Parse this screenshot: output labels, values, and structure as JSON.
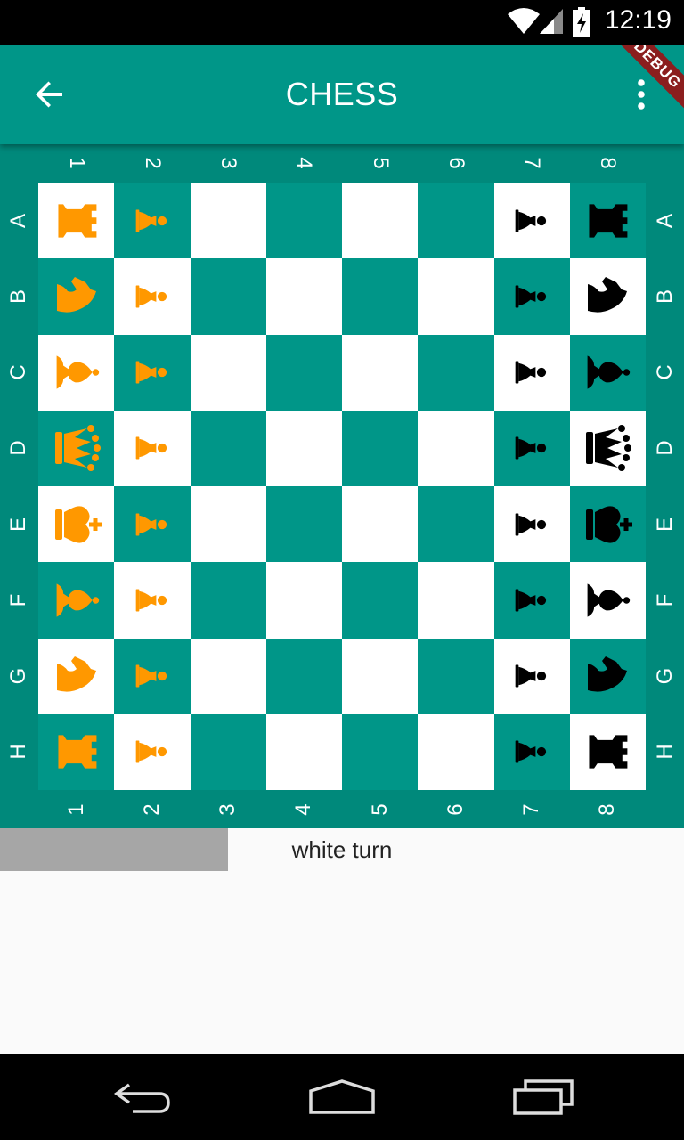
{
  "status_bar": {
    "time": "12:19"
  },
  "app_bar": {
    "title": "CHESS",
    "debug_banner": "DEBUG"
  },
  "board": {
    "column_labels": [
      "1",
      "2",
      "3",
      "4",
      "5",
      "6",
      "7",
      "8"
    ],
    "row_labels": [
      "A",
      "B",
      "C",
      "D",
      "E",
      "F",
      "G",
      "H"
    ],
    "colors": {
      "light_square": "#ffffff",
      "dark_square": "#009688",
      "frame": "#00897b",
      "white_pieces": "#ff9800",
      "black_pieces": "#000000"
    },
    "rows": [
      [
        "wR",
        "wP",
        "",
        "",
        "",
        "",
        "bP",
        "bR"
      ],
      [
        "wN",
        "wP",
        "",
        "",
        "",
        "",
        "bP",
        "bN"
      ],
      [
        "wB",
        "wP",
        "",
        "",
        "",
        "",
        "bP",
        "bB"
      ],
      [
        "wQ",
        "wP",
        "",
        "",
        "",
        "",
        "bP",
        "bQ"
      ],
      [
        "wK",
        "wP",
        "",
        "",
        "",
        "",
        "bP",
        "bK"
      ],
      [
        "wB",
        "wP",
        "",
        "",
        "",
        "",
        "bP",
        "bB"
      ],
      [
        "wN",
        "wP",
        "",
        "",
        "",
        "",
        "bP",
        "bN"
      ],
      [
        "wR",
        "wP",
        "",
        "",
        "",
        "",
        "bP",
        "bR"
      ]
    ]
  },
  "turn": {
    "text": "white turn",
    "progress": 0.333
  },
  "nav_bar": {
    "icons": [
      "back-icon",
      "home-icon",
      "recents-icon"
    ]
  }
}
